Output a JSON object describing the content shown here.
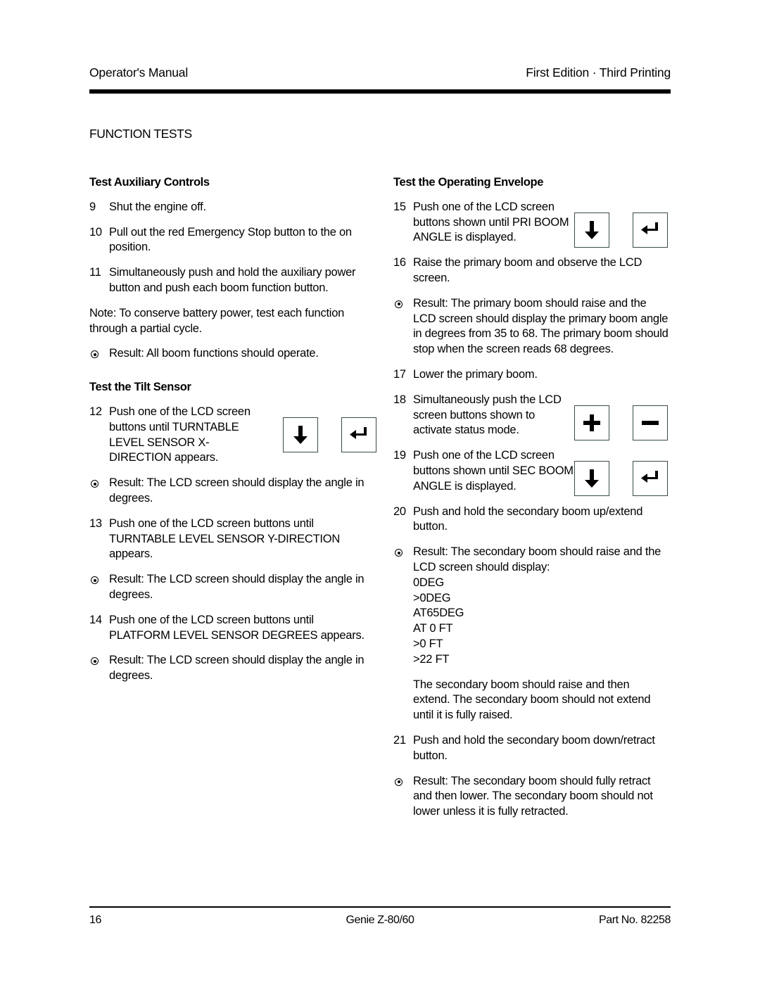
{
  "header": {
    "left": "Operator's Manual",
    "right": "First Edition · Third Printing"
  },
  "section_title": "FUNCTION TESTS",
  "left_column": {
    "heading_auxiliary": "Test Auxiliary Controls",
    "step9_num": "9",
    "step9_text": "Shut the engine off.",
    "step10_num": "10",
    "step10_text": "Pull out the red Emergency Stop button to the on position.",
    "step11_num": "11",
    "step11_text": "Simultaneously push and hold the auxiliary power button and push each boom function button.",
    "note": "Note: To conserve battery power, test each function through a partial cycle.",
    "result_aux": "Result: All boom functions should operate.",
    "heading_tilt": "Test the Tilt Sensor",
    "step12_num": "12",
    "step12_text": "Push one of the LCD screen buttons until TURNTABLE LEVEL SENSOR X-DIRECTION appears.",
    "result12": "Result: The LCD screen should display the angle in degrees.",
    "step13_num": "13",
    "step13_text": "Push one of the LCD screen buttons until TURNTABLE LEVEL SENSOR Y-DIRECTION appears.",
    "result13": "Result: The LCD screen should display the angle in degrees.",
    "step14_num": "14",
    "step14_text": "Push one of the LCD screen buttons until PLATFORM LEVEL SENSOR DEGREES appears.",
    "result14": "Result: The LCD screen should display the angle in degrees."
  },
  "right_column": {
    "heading_envelope": "Test the Operating Envelope",
    "step15_num": "15",
    "step15_text": "Push one of the LCD screen buttons shown until PRI BOOM ANGLE is displayed.",
    "step16_num": "16",
    "step16_text": "Raise the primary boom and observe the LCD screen.",
    "result16": "Result: The primary boom should raise and the LCD screen should display the primary boom angle in degrees from 35 to 68. The primary boom should stop when the screen reads 68 degrees.",
    "step17_num": "17",
    "step17_text": "Lower the primary boom.",
    "step18_num": "18",
    "step18_text": "Simultaneously push the LCD screen buttons shown to activate status mode.",
    "step19_num": "19",
    "step19_text": "Push one of the LCD screen buttons shown until SEC BOOM ANGLE is displayed.",
    "step20_num": "20",
    "step20_text": "Push and hold the secondary boom up/extend button.",
    "result20_intro": "Result: The secondary boom should raise and the LCD screen should display:",
    "readout": [
      "0DEG",
      ">0DEG",
      "AT65DEG",
      "AT 0 FT",
      ">0 FT",
      ">22 FT"
    ],
    "result20_note": "The secondary boom should raise and then extend. The secondary boom should not extend until it is fully raised.",
    "step21_num": "21",
    "step21_text": "Push and hold the secondary boom down/retract button.",
    "result21": "Result: The secondary boom should fully retract and then lower. The secondary boom should not lower unless it is fully retracted."
  },
  "footer": {
    "page_number": "16",
    "model": "Genie Z-80/60",
    "part_number": "Part No. 82258"
  }
}
